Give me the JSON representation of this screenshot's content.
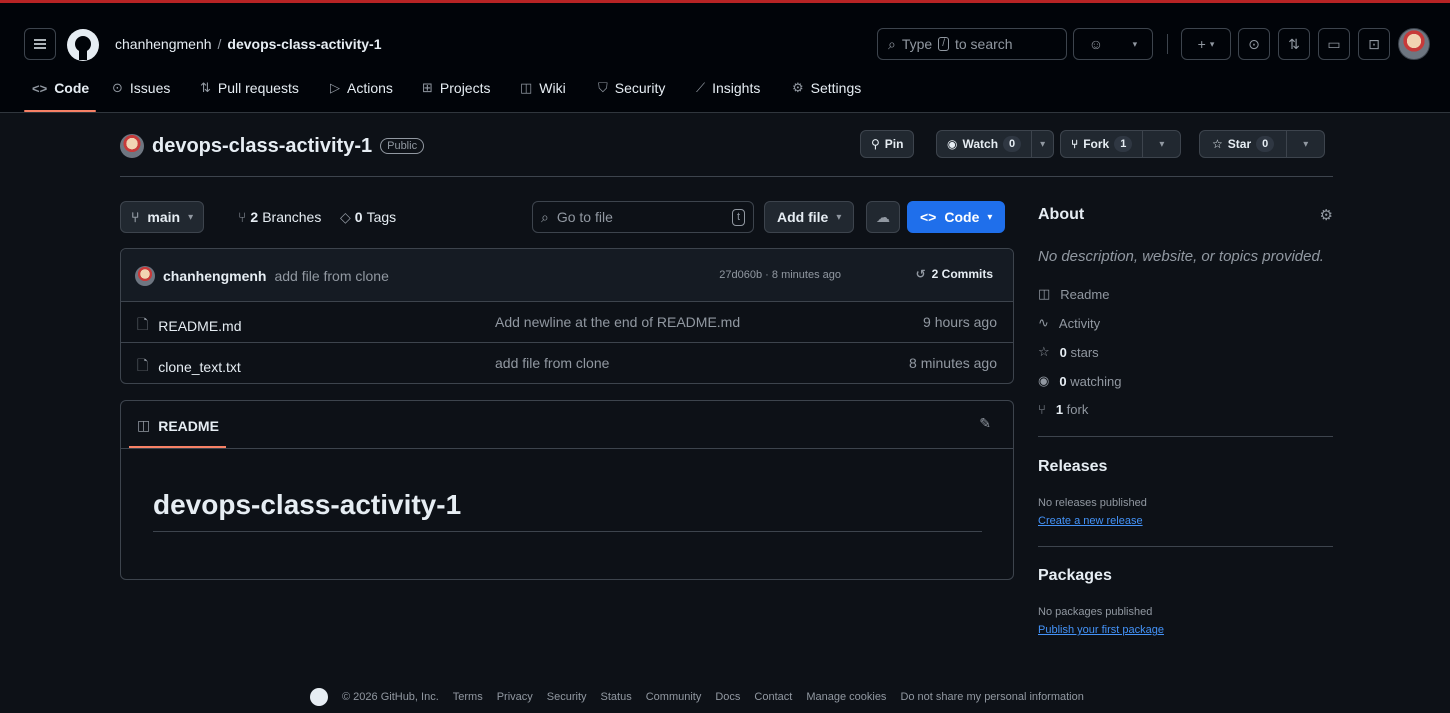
{
  "nav": {
    "owner": "chanhengmenh",
    "separator": "/",
    "repo": "devops-class-activity-1",
    "search_prefix": "Type",
    "search_key": "/",
    "search_suffix": "to search",
    "tabs": [
      {
        "label": "Code",
        "icon": "code-icon"
      },
      {
        "label": "Issues",
        "icon": "issue-icon"
      },
      {
        "label": "Pull requests",
        "icon": "pull-request-icon"
      },
      {
        "label": "Actions",
        "icon": "play-icon"
      },
      {
        "label": "Projects",
        "icon": "table-icon"
      },
      {
        "label": "Wiki",
        "icon": "book-icon"
      },
      {
        "label": "Security",
        "icon": "shield-icon"
      },
      {
        "label": "Insights",
        "icon": "graph-icon"
      },
      {
        "label": "Settings",
        "icon": "gear-icon"
      }
    ]
  },
  "repo_header": {
    "name": "devops-class-activity-1",
    "visibility": "Public",
    "pin": "Pin",
    "watch": "Watch",
    "watch_count": "0",
    "fork": "Fork",
    "fork_count": "1",
    "star": "Star",
    "star_count": "0"
  },
  "toolbar": {
    "branch": "main",
    "branches_count": "2",
    "branches_label": "Branches",
    "tags_count": "0",
    "tags_label": "Tags",
    "goto_placeholder": "Go to file",
    "goto_key": "t",
    "add_file": "Add file",
    "code": "Code"
  },
  "latest_commit": {
    "author": "chanhengmenh",
    "message": "add file from clone",
    "meta": "27d060b · 8 minutes ago",
    "commits": "2 Commits"
  },
  "files": [
    {
      "name": "README.md",
      "message": "Add newline at the end of README.md",
      "time": "9 hours ago"
    },
    {
      "name": "clone_text.txt",
      "message": "add file from clone",
      "time": "8 minutes ago"
    }
  ],
  "readme": {
    "tab": "README",
    "heading": "devops-class-activity-1"
  },
  "about": {
    "title": "About",
    "description": "No description, website, or topics provided.",
    "readme": "Readme",
    "activity": "Activity",
    "stars_count": "0",
    "stars_label": "stars",
    "watching_count": "0",
    "watching_label": "watching",
    "forks_count": "1",
    "forks_label": "fork"
  },
  "releases": {
    "title": "Releases",
    "none": "No releases published",
    "create": "Create a new release"
  },
  "packages": {
    "title": "Packages",
    "none": "No packages published",
    "publish": "Publish your first package"
  },
  "footer": {
    "copyright": "© 2026 GitHub, Inc.",
    "links": [
      "Terms",
      "Privacy",
      "Security",
      "Status",
      "Community",
      "Docs",
      "Contact",
      "Manage cookies",
      "Do not share my personal information"
    ]
  },
  "colors": {
    "background": "#0d1117",
    "header": "#010409",
    "border": "#3d444d",
    "accent_blue": "#1f6feb",
    "link": "#4493f8",
    "tab_underline": "#f78166"
  }
}
